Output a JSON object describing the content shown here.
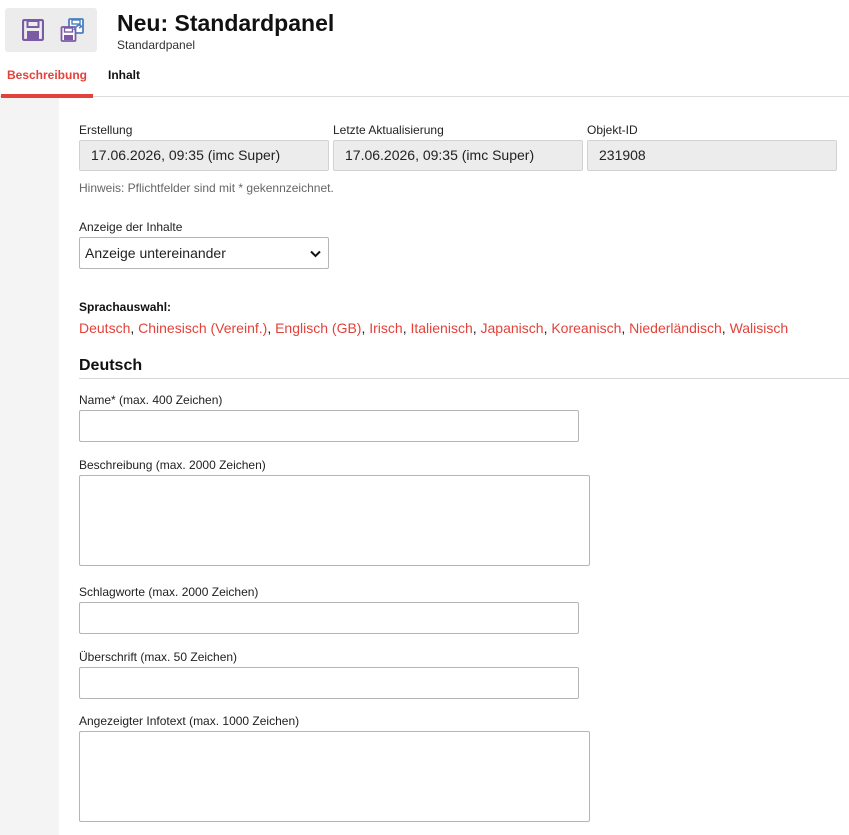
{
  "header": {
    "title": "Neu: Standardpanel",
    "subtitle": "Standardpanel",
    "toolbar": {
      "save_icon": "floppy-disk-icon",
      "save_as_icon": "save-as-copy-icon"
    }
  },
  "tabs": [
    {
      "label": "Beschreibung",
      "active": true
    },
    {
      "label": "Inhalt",
      "active": false
    }
  ],
  "meta": {
    "created_label": "Erstellung",
    "created_value": "17.06.2026, 09:35 (imc Super)",
    "updated_label": "Letzte Aktualisierung",
    "updated_value": "17.06.2026, 09:35 (imc Super)",
    "id_label": "Objekt-ID",
    "id_value": "231908"
  },
  "hint": "Hinweis: Pflichtfelder sind mit * gekennzeichnet.",
  "display": {
    "label": "Anzeige der Inhalte",
    "selected": "Anzeige untereinander"
  },
  "languages": {
    "label": "Sprachauswahl:",
    "items": [
      "Deutsch",
      "Chinesisch (Vereinf.)",
      "Englisch (GB)",
      "Irisch",
      "Italienisch",
      "Japanisch",
      "Koreanisch",
      "Niederländisch",
      "Walisisch"
    ],
    "separator": ", "
  },
  "section": {
    "title": "Deutsch"
  },
  "fields": {
    "name_label": "Name* (max. 400 Zeichen)",
    "name_value": "",
    "description_label": "Beschreibung (max. 2000 Zeichen)",
    "description_value": "",
    "keywords_label": "Schlagworte (max. 2000 Zeichen)",
    "keywords_value": "",
    "heading_label": "Überschrift (max. 50 Zeichen)",
    "heading_value": "",
    "infotext_label": "Angezeigter Infotext (max. 1000 Zeichen)",
    "infotext_value": ""
  },
  "colors": {
    "accent": "#e3423a",
    "icon_purple": "#7b5aa6",
    "icon_blue": "#4a7fc1"
  }
}
